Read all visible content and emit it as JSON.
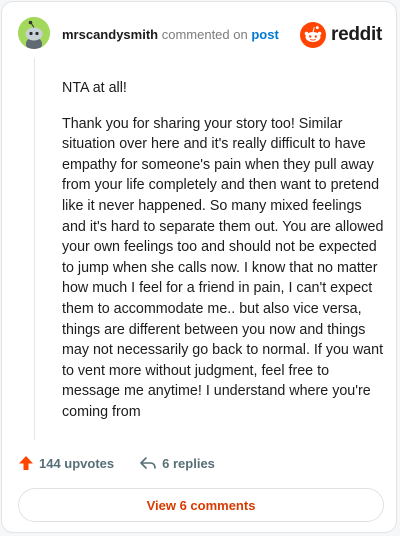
{
  "comment": {
    "username": "mrscandysmith",
    "action_text": "commented on",
    "post_link": "post",
    "paragraphs": [
      "NTA at all!",
      "Thank you for sharing your story too! Similar situation over here and it's really difficult to have empathy for someone's pain when they pull away from your life completely and then want to pretend like it never happened. So many mixed feelings and it's hard to separate them out. You are allowed your own feelings too and should not be expected to jump when she calls now. I know that no matter how much I feel for a friend in pain, I can't expect them to accommodate me.. but also vice versa, things are different between you now and things may not necessarily go back to normal. If you want to vent more without judgment, feel free to message me anytime! I understand where you're coming from"
    ],
    "upvotes": "144 upvotes",
    "replies": "6 replies",
    "view_comments": "View 6 comments"
  },
  "brand": {
    "name": "reddit"
  },
  "icons": {
    "avatar": "snoo-avatar",
    "logo": "reddit-logo-icon",
    "upvote": "upvote-arrow-icon",
    "reply": "reply-arrow-icon"
  },
  "colors": {
    "accent": "#ff4500",
    "link": "#0079d3",
    "avatar_bg": "#a3d95b",
    "view_button_text": "#d93a00"
  }
}
